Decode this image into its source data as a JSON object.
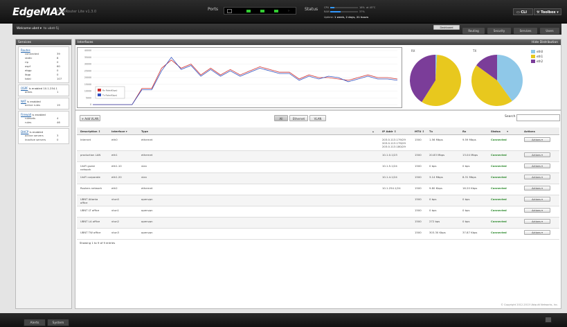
{
  "header": {
    "logo_main": "EdgeMAX",
    "logo_sub": "EdgeRouter Lite v1.3.0",
    "ports_label": "Ports",
    "status_label": "Status",
    "cpu_label": "CPU",
    "cpu_value": "16%",
    "temp_value": "at 45°C",
    "ram_label": "RAM",
    "ram_value": "37%",
    "uptime_label": "Uptime:",
    "uptime_value": "1 week, 2 days, 21 hours",
    "cli_label": "CLI",
    "toolbox_label": "Toolbox",
    "cpu_pct": 16,
    "ram_pct": 37
  },
  "nav": {
    "user": "Welcome ubnt",
    "host": "to ubnt-5j",
    "tabs": [
      "Dashboard",
      "Routing",
      "Security",
      "Services",
      "Users"
    ],
    "active_tab": "Dashboard"
  },
  "sidebar": {
    "title": "Services",
    "routes": {
      "link": "Routes",
      "rows": [
        [
          "connected",
          "39"
        ],
        [
          "static",
          "8"
        ],
        [
          "rip",
          "0"
        ],
        [
          "ospf",
          "60"
        ],
        [
          "ebgp",
          "0"
        ],
        [
          "ibgp",
          "0"
        ],
        [
          "total",
          "107"
        ]
      ]
    },
    "ospf": {
      "link": "OSPF",
      "text": "is enabled",
      "id": "10.1.254.1",
      "rows": [
        [
          "areas",
          "1"
        ]
      ]
    },
    "nat": {
      "link": "NAT",
      "text": "is enabled",
      "rows": [
        [
          "active rules",
          "19"
        ]
      ]
    },
    "firewall": {
      "link": "Firewall",
      "text": "is enabled",
      "rows": [
        [
          "rulesets",
          "4"
        ],
        [
          "rules",
          "46"
        ]
      ]
    },
    "dhcp": {
      "link": "DHCP",
      "text": "is enabled",
      "rows": [
        [
          "active servers",
          "3"
        ],
        [
          "inactive servers",
          "0"
        ]
      ]
    }
  },
  "interfaces_panel": {
    "title": "Interfaces",
    "hide": "Hide Distribution",
    "rx_label": "RX",
    "tx_label": "TX",
    "legend": [
      {
        "name": "eth0",
        "color": "#8fc8e8"
      },
      {
        "name": "eth1",
        "color": "#e8c81e"
      },
      {
        "name": "eth2",
        "color": "#7b3d99"
      }
    ]
  },
  "chart_data": [
    {
      "type": "line",
      "y_ticks": [
        "40000",
        "35000",
        "30000",
        "25000",
        "20000",
        "15000",
        "10000",
        "5000",
        "0"
      ],
      "ylim": [
        0,
        40000
      ],
      "series": [
        {
          "name": "Rx Rate(Kbps)",
          "color": "#d03030",
          "values": [
            0,
            0,
            0,
            0,
            0,
            12000,
            12000,
            27000,
            33000,
            27000,
            30000,
            22000,
            27000,
            22000,
            26000,
            22000,
            25000,
            28000,
            26000,
            24000,
            24000,
            19000,
            22000,
            20000,
            20000,
            19000,
            18000,
            20000,
            22000,
            20000,
            20000,
            19000
          ]
        },
        {
          "name": "Tx Rate(Kbps)",
          "color": "#3050c0",
          "values": [
            0,
            0,
            0,
            0,
            0,
            11000,
            11000,
            25000,
            35000,
            26000,
            29000,
            21000,
            26000,
            21000,
            25000,
            21000,
            24000,
            27000,
            25000,
            23000,
            23000,
            18000,
            21000,
            19000,
            21000,
            20000,
            17000,
            19000,
            21000,
            19000,
            19000,
            18000
          ]
        }
      ]
    },
    {
      "type": "pie",
      "title": "RX",
      "series": [
        {
          "name": "eth0",
          "values": [
            1
          ]
        },
        {
          "name": "eth1",
          "values": [
            58
          ]
        },
        {
          "name": "eth2",
          "values": [
            41
          ]
        }
      ]
    },
    {
      "type": "pie",
      "title": "TX",
      "series": [
        {
          "name": "eth0",
          "values": [
            40
          ]
        },
        {
          "name": "eth1",
          "values": [
            45
          ]
        },
        {
          "name": "eth2",
          "values": [
            15
          ]
        }
      ]
    }
  ],
  "toolbar": {
    "add": "+ Add VLAN",
    "filters": [
      "All",
      "Ethernet",
      "VLAN"
    ],
    "search": "Search"
  },
  "table": {
    "headers": [
      "Description",
      "Interface",
      "Type",
      "IP Addr",
      "MTU",
      "Tx",
      "Rx",
      "Status",
      "Actions"
    ],
    "rows": [
      {
        "desc": "Internet",
        "iface": "eth0",
        "type": "ethernet",
        "ip": "203.0.113.179/29\n203.0.113.179/29\n203.0.113.180/29",
        "mtu": "1500",
        "tx": "1.56 Mbps",
        "rx": "9.59 Mbps",
        "status": "Connected",
        "action": "Actions"
      },
      {
        "desc": "production LAN",
        "iface": "eth1",
        "type": "ethernet",
        "ip": "10.1.0.1/23",
        "mtu": "1500",
        "tx": "20.83 Mbps",
        "rx": "13.04 Mbps",
        "status": "Connected",
        "action": "Actions"
      },
      {
        "desc": "UniFi guest network",
        "iface": "eth1.10",
        "type": "vlan",
        "ip": "10.1.5.1/24",
        "mtu": "1500",
        "tx": "0 bps",
        "rx": "0 bps",
        "status": "Connected",
        "action": "Actions"
      },
      {
        "desc": "UniFi corporate",
        "iface": "eth1.20",
        "type": "vlan",
        "ip": "10.1.4.1/24",
        "mtu": "1500",
        "tx": "3.14 Mbps",
        "rx": "8.31 Mbps",
        "status": "Connected",
        "action": "Actions"
      },
      {
        "desc": "Routers network",
        "iface": "eth2",
        "type": "ethernet",
        "ip": "10.1.254.1/24",
        "mtu": "1500",
        "tx": "9.80 Kbps",
        "rx": "16.20 Kbps",
        "status": "Connected",
        "action": "Actions"
      },
      {
        "desc": "UBNT Atlanta office",
        "iface": "vtun0",
        "type": "openvpn",
        "ip": "",
        "mtu": "1500",
        "tx": "0 bps",
        "rx": "0 bps",
        "status": "Connected",
        "action": "Actions"
      },
      {
        "desc": "UBNT LT office",
        "iface": "vtun1",
        "type": "openvpn",
        "ip": "",
        "mtu": "1500",
        "tx": "0 bps",
        "rx": "0 bps",
        "status": "Connected",
        "action": "Actions"
      },
      {
        "desc": "UBNT LA office",
        "iface": "vtun2",
        "type": "openvpn",
        "ip": "",
        "mtu": "1500",
        "tx": "272 bps",
        "rx": "0 bps",
        "status": "Connected",
        "action": "Actions"
      },
      {
        "desc": "UBNT TW office",
        "iface": "vtun3",
        "type": "openvpn",
        "ip": "",
        "mtu": "1500",
        "tx": "303.30 Kbps",
        "rx": "37.87 Kbps",
        "status": "Connected",
        "action": "Actions"
      }
    ],
    "showing": "Showing 1 to 9 of 9 entries"
  },
  "footer": {
    "copyright": "© Copyright 2012-2013 Ubiquiti Networks, Inc.",
    "tabs": [
      "Alerts",
      "System"
    ]
  }
}
